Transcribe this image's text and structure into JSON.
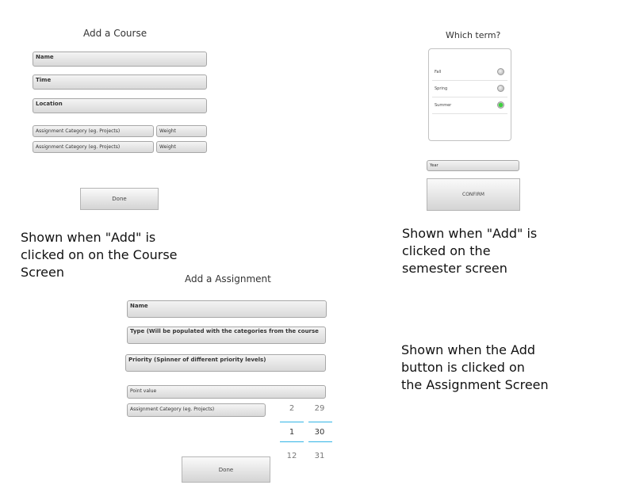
{
  "add_course": {
    "title": "Add a Course",
    "fields": {
      "name": "Name",
      "time": "Time",
      "location": "Location",
      "category_1": "Assignment Category (eg. Projects)",
      "weight_1": "Weight",
      "category_2": "Assignment Category (eg. Projects)",
      "weight_2": "Weight"
    },
    "done_label": "Done",
    "note": "Shown when \"Add\" is\nclicked on on the Course\nScreen"
  },
  "which_term": {
    "title": "Which term?",
    "options": [
      {
        "label": "Fall",
        "selected": false
      },
      {
        "label": "Spring",
        "selected": false
      },
      {
        "label": "Summer",
        "selected": true
      }
    ],
    "year_placeholder": "Year",
    "confirm_label": "CONFIRM",
    "note": "Shown when \"Add\" is\nclicked on the\nsemester screen"
  },
  "add_assignment": {
    "title": "Add a Assignment",
    "fields": {
      "name": "Name",
      "type": "Type (Will be populated with the categories from the course",
      "priority": "Priority (Spinner of different priority levels)",
      "point_value": "Point value",
      "category": "Assignment Category (eg. Projects)"
    },
    "date_picker": {
      "col1": [
        "2",
        "1",
        "12"
      ],
      "col2": [
        "29",
        "30",
        "31"
      ]
    },
    "done_label": "Done",
    "note": "Shown when the Add\nbutton is clicked on\nthe Assignment Screen"
  },
  "colors": {
    "accent": "#33b5e5",
    "radio_selected": "#3fd03f"
  }
}
